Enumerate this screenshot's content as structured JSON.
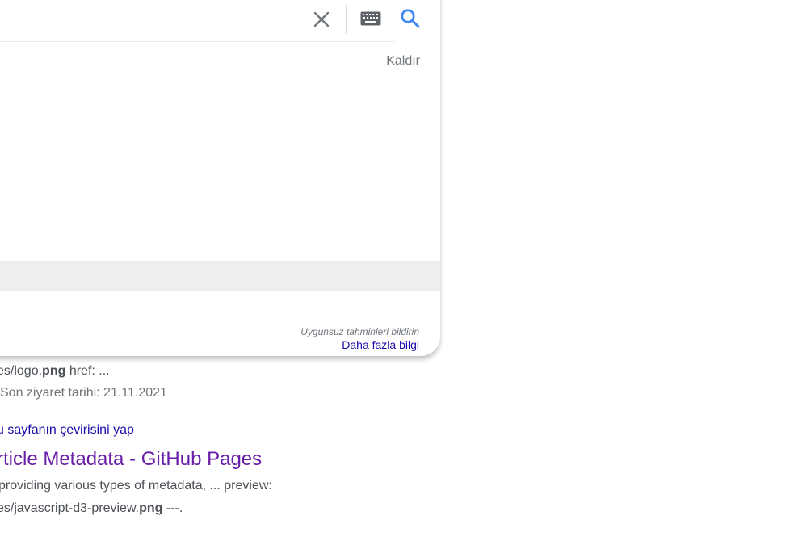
{
  "dropdown": {
    "remove_label": "Kaldır",
    "report_label": "Uygunsuz tahminleri bildirin",
    "more_info_label": "Daha fazla bilgi"
  },
  "results": {
    "snippet_top_fragment": "",
    "first": {
      "snippet_prefix": "es/logo.",
      "snippet_bold": "png",
      "snippet_suffix": " href: ...",
      "visited": "Son ziyaret tarihi: 21.11.2021"
    },
    "second": {
      "translate_label": "u sayfanın çevirisini yap",
      "title": "rticle Metadata - GitHub Pages",
      "snippet_line1": "providing various types of metadata, ... preview:",
      "snippet_line2_prefix": "es/javascript-d3-preview.",
      "snippet_line2_bold": "png",
      "snippet_line2_suffix": " ---."
    }
  },
  "icons": {
    "clear": "close-icon",
    "keyboard": "keyboard-icon",
    "search": "search-icon"
  },
  "colors": {
    "link": "#1a0dab",
    "visited_title": "#681da8",
    "search_icon": "#4285f4"
  }
}
